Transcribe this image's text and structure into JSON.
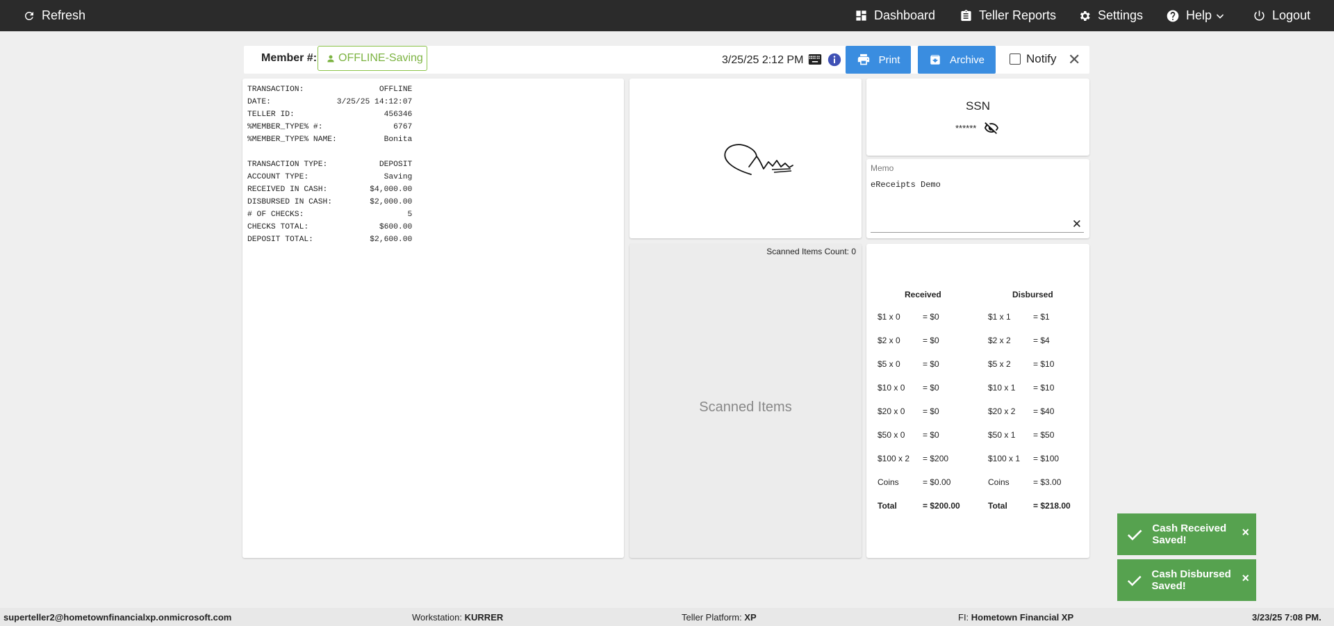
{
  "topbar": {
    "refresh_label": "Refresh",
    "dashboard_label": "Dashboard",
    "teller_reports_label": "Teller Reports",
    "settings_label": "Settings",
    "help_label": "Help",
    "logout_label": "Logout"
  },
  "header": {
    "member_label": "Member #:",
    "member_value": "OFFLINE-Saving",
    "datetime": "3/25/25 2:12 PM",
    "print_label": "Print",
    "archive_label": "Archive",
    "notify_label": "Notify",
    "close_label": "✕"
  },
  "receipt": {
    "lines": [
      [
        "TRANSACTION:",
        "OFFLINE"
      ],
      [
        "DATE:",
        "3/25/25 14:12:07"
      ],
      [
        "TELLER ID:",
        "456346"
      ],
      [
        "%MEMBER_TYPE% #:",
        "6767"
      ],
      [
        "%MEMBER_TYPE% NAME:",
        "Bonita"
      ],
      [
        "",
        ""
      ],
      [
        "TRANSACTION TYPE:",
        "DEPOSIT"
      ],
      [
        "ACCOUNT TYPE:",
        "Saving"
      ],
      [
        "RECEIVED IN CASH:",
        "$4,000.00"
      ],
      [
        "DISBURSED IN CASH:",
        "$2,000.00"
      ],
      [
        "# OF CHECKS:",
        "5"
      ],
      [
        "CHECKS TOTAL:",
        "$600.00"
      ],
      [
        "DEPOSIT TOTAL:",
        "$2,600.00"
      ]
    ]
  },
  "scanned": {
    "count_label": "Scanned Items Count: 0",
    "title": "Scanned Items"
  },
  "ssn": {
    "title": "SSN",
    "masked_value": "******"
  },
  "memo": {
    "label": "Memo",
    "value": "eReceipts Demo",
    "clear_label": "✕"
  },
  "cash": {
    "received_header": "Received",
    "disbursed_header": "Disbursed",
    "received": [
      [
        "$1 x 0",
        "= $0"
      ],
      [
        "$2 x 0",
        "= $0"
      ],
      [
        "$5 x 0",
        "= $0"
      ],
      [
        "$10 x 0",
        "= $0"
      ],
      [
        "$20 x 0",
        "= $0"
      ],
      [
        "$50 x 0",
        "= $0"
      ],
      [
        "$100 x 2",
        "= $200"
      ],
      [
        "Coins",
        "= $0.00"
      ],
      [
        "Total",
        "= $200.00"
      ]
    ],
    "disbursed": [
      [
        "$1 x 1",
        "= $1"
      ],
      [
        "$2 x 2",
        "= $4"
      ],
      [
        "$5 x 2",
        "= $10"
      ],
      [
        "$10 x 1",
        "= $10"
      ],
      [
        "$20 x 2",
        "= $40"
      ],
      [
        "$50 x 1",
        "= $50"
      ],
      [
        "$100 x 1",
        "= $100"
      ],
      [
        "Coins",
        "= $3.00"
      ],
      [
        "Total",
        "= $218.00"
      ]
    ]
  },
  "toasts": {
    "received": "Cash Received Saved!",
    "disbursed": "Cash Disbursed Saved!",
    "close_label": "×"
  },
  "footer": {
    "user": "superteller2@hometownfinancialxp.onmicrosoft.com",
    "workstation_label": "Workstation:",
    "workstation_value": "KURRER",
    "platform_label": "Teller Platform:",
    "platform_value": "XP",
    "fi_label": "FI:",
    "fi_value": "Hometown Financial XP",
    "datetime": "3/23/25 7:08 PM."
  },
  "colors": {
    "topbar": "#2b2b2b",
    "accent_blue": "#3a8de0",
    "member_green": "#7cb342",
    "toast_green": "#56a24f"
  }
}
